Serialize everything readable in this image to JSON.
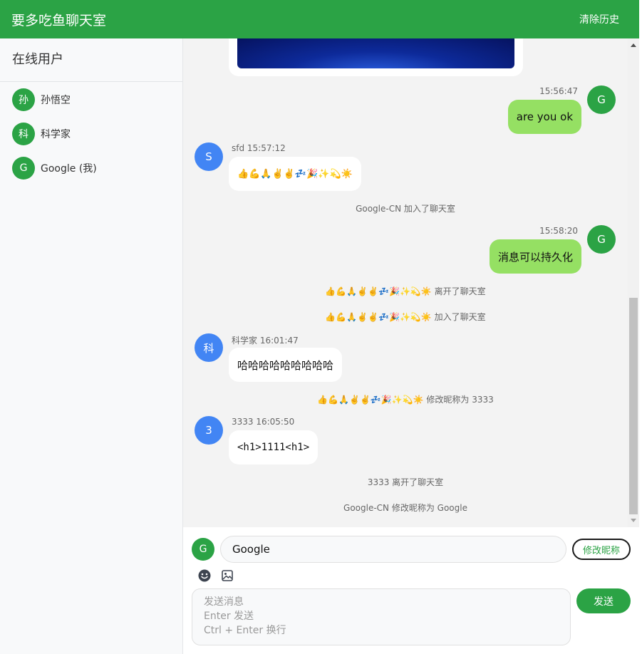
{
  "header": {
    "title": "要多吃鱼聊天室",
    "clear_label": "清除历史"
  },
  "sidebar": {
    "title": "在线用户",
    "users": [
      {
        "avatar": "孙",
        "name": "孙悟空"
      },
      {
        "avatar": "科",
        "name": "科学家"
      },
      {
        "avatar": "G",
        "name": "Google (我)"
      }
    ]
  },
  "messages": {
    "m1": {
      "avatar": "G",
      "time": "15:56:47",
      "text": "are you ok"
    },
    "m2": {
      "avatar": "S",
      "meta": "sfd 15:57:12",
      "text": "👍💪🙏✌️✌️💤🎉✨💫☀️"
    },
    "s1": "Google-CN 加入了聊天室",
    "m3": {
      "avatar": "G",
      "time": "15:58:20",
      "text": "消息可以持久化"
    },
    "s2": "👍💪🙏✌️✌️💤🎉✨💫☀️ 离开了聊天室",
    "s3": "👍💪🙏✌️✌️💤🎉✨💫☀️ 加入了聊天室",
    "m4": {
      "avatar": "科",
      "meta": "科学家 16:01:47",
      "text": "哈哈哈哈哈哈哈哈哈"
    },
    "s4": "👍💪🙏✌️✌️💤🎉✨💫☀️ 修改昵称为 3333",
    "m5": {
      "avatar": "3",
      "meta": "3333 16:05:50",
      "text": "<h1>1111<h1>"
    },
    "s5": "3333 离开了聊天室",
    "s6": "Google-CN 修改昵称为 Google"
  },
  "composer": {
    "avatar": "G",
    "nickname_value": "Google",
    "nickname_button": "修改昵称",
    "message_placeholder": "发送消息\nEnter 发送\nCtrl + Enter 换行",
    "send_label": "发送",
    "tools": [
      "emoji-icon",
      "image-icon"
    ]
  },
  "colors": {
    "brand": "#2ba345",
    "my_bubble": "#95e063",
    "other_avatar": "#4285f4"
  }
}
